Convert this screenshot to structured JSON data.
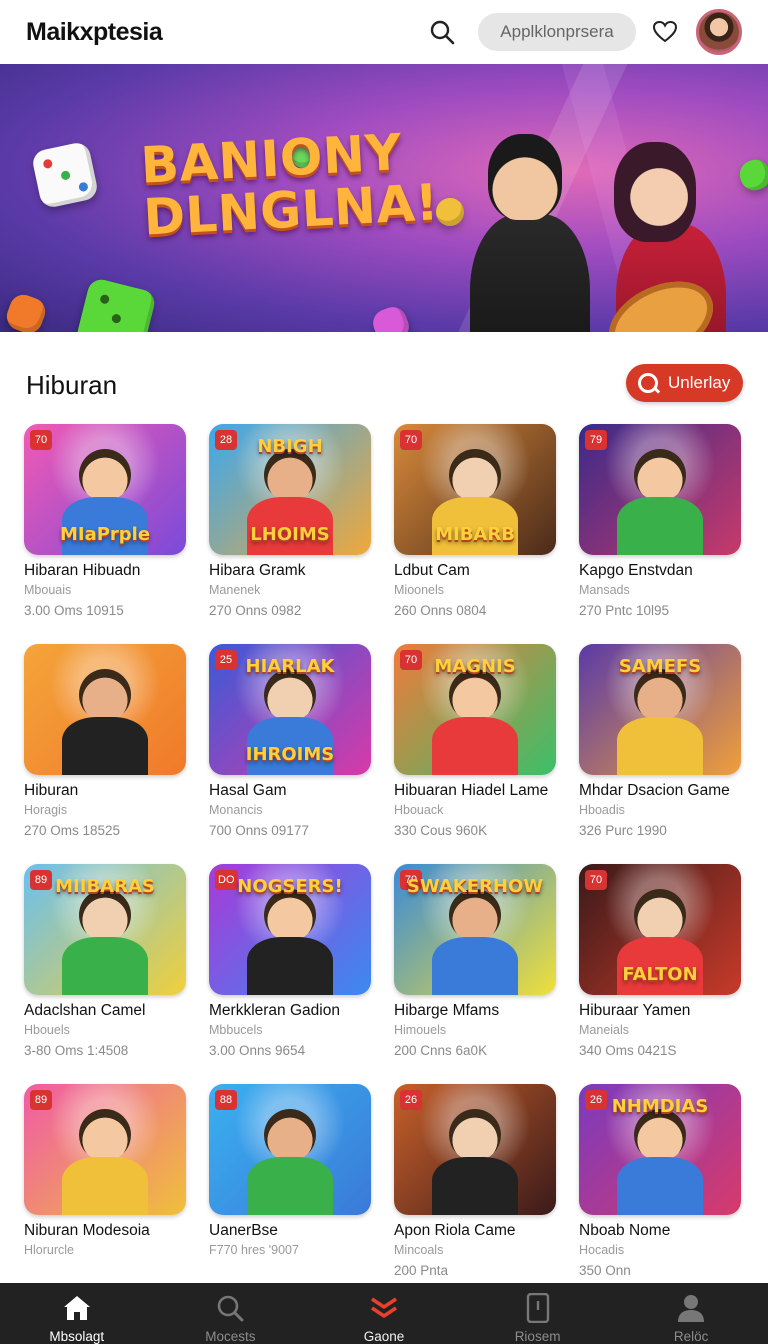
{
  "header": {
    "app_title": "Maikxptesia",
    "search_pill_text": "Applklonprsera",
    "icons": [
      "search-icon",
      "heart-icon",
      "avatar"
    ]
  },
  "banner": {
    "title_line1": "BANIONY",
    "title_line2": "DLNGLNA!"
  },
  "section": {
    "title": "Hiburan",
    "action_label": "Unlerlay"
  },
  "games": [
    {
      "badge": "70",
      "thumb_text": "MIaPrple",
      "title": "Hibaran Hibuadn",
      "sub": "Mbouais",
      "meta": "3.00 Oms 10915",
      "theme": [
        "#f25ab4",
        "#7a4ad8"
      ]
    },
    {
      "badge": "28",
      "thumb_text": "LHOIMS",
      "thumb_top": "NBIGH",
      "title": "Hibara Gramk",
      "sub": "Manenek",
      "meta": "270 Onns 0982",
      "theme": [
        "#3aa8f0",
        "#f0a83a"
      ]
    },
    {
      "badge": "70",
      "thumb_text": "MIBARB",
      "title": "Ldbut Cam",
      "sub": "Mioonels",
      "meta": "260 Onns 0804",
      "theme": [
        "#d88a3a",
        "#4a2a1a"
      ]
    },
    {
      "badge": "79",
      "thumb_text": "",
      "title": "Kapgo Enstvdan",
      "sub": "Mansads",
      "meta": "270 Pntc 10l95",
      "theme": [
        "#3a2a8a",
        "#c83a6a"
      ]
    },
    {
      "badge": "",
      "thumb_text": "",
      "title": "Hiburan",
      "sub": "Horagis",
      "meta": "270 Oms 18525",
      "theme": [
        "#f4a43a",
        "#f07a2a"
      ]
    },
    {
      "badge": "25",
      "thumb_text": "IHROIMS",
      "thumb_top": "HIARLAK",
      "title": "Hasal Gam",
      "sub": "Monancis",
      "meta": "700 Onns 09177",
      "theme": [
        "#3a5ad8",
        "#d83aa8"
      ]
    },
    {
      "badge": "70",
      "thumb_text": "",
      "thumb_top": "MAGNIS",
      "title": "Hibuaran Hiadel Lame",
      "sub": "Hbouack",
      "meta": "330 Cous 960K",
      "theme": [
        "#f07a3a",
        "#3ac06a"
      ]
    },
    {
      "badge": "",
      "thumb_text": "",
      "thumb_top": "SAMEFS",
      "title": "Mhdar Dsacion Game",
      "sub": "Hboadis",
      "meta": "326 Purc 1990",
      "theme": [
        "#5a3aa8",
        "#f0a03a"
      ]
    },
    {
      "badge": "89",
      "thumb_text": "",
      "thumb_top": "MIIBARAS",
      "title": "Adaclshan Camel",
      "sub": "Hbouels",
      "meta": "3-80 Oms 1:4508",
      "theme": [
        "#6ac0f0",
        "#f0d03a"
      ]
    },
    {
      "badge": "DO",
      "thumb_text": "",
      "thumb_top": "NOGSERS!",
      "title": "Merkkleran Gadion",
      "sub": "Mbbucels",
      "meta": "3.00 Onns 9654",
      "theme": [
        "#a83ad8",
        "#3a8af0"
      ]
    },
    {
      "badge": "79",
      "thumb_text": "",
      "thumb_top": "SWAKERHOW",
      "title": "Hibarge Mfams",
      "sub": "Himouels",
      "meta": "200 Cnns 6a0K",
      "theme": [
        "#3a8ad8",
        "#f0e03a"
      ]
    },
    {
      "badge": "70",
      "thumb_text": "FALTON",
      "title": "Hiburaar Yamen",
      "sub": "Maneials",
      "meta": "340 Oms 0421S",
      "theme": [
        "#3a1a1a",
        "#c83a2a"
      ]
    },
    {
      "badge": "89",
      "thumb_text": "",
      "title": "Niburan Modesoia",
      "sub": "Hlorurcle",
      "meta": "",
      "theme": [
        "#f05aa8",
        "#f0c03a"
      ]
    },
    {
      "badge": "88",
      "thumb_text": "",
      "title": "UanerBse",
      "sub": "F770 hres '9007",
      "meta": "",
      "theme": [
        "#3ab0f0",
        "#3a7ad8"
      ]
    },
    {
      "badge": "26",
      "thumb_text": "",
      "title": "Apon Riola Came",
      "sub": "Mincoals",
      "meta": "200 Pnta",
      "theme": [
        "#c8602a",
        "#3a1a1a"
      ]
    },
    {
      "badge": "26",
      "thumb_text": "",
      "thumb_top": "NHMDIAS",
      "title": "Nboab Nome",
      "sub": "Hocadis",
      "meta": "350 Onn",
      "theme": [
        "#7a3ac0",
        "#d83a6a"
      ]
    }
  ],
  "bottom_nav": [
    {
      "label": "Mbsolagt",
      "icon": "home-icon",
      "state": "active"
    },
    {
      "label": "Mocests",
      "icon": "search-icon",
      "state": "inactive"
    },
    {
      "label": "Gaone",
      "icon": "chevrons-icon",
      "state": "game"
    },
    {
      "label": "Riosem",
      "icon": "phone-icon",
      "state": "inactive"
    },
    {
      "label": "Relöc",
      "icon": "profile-icon",
      "state": "inactive"
    }
  ]
}
